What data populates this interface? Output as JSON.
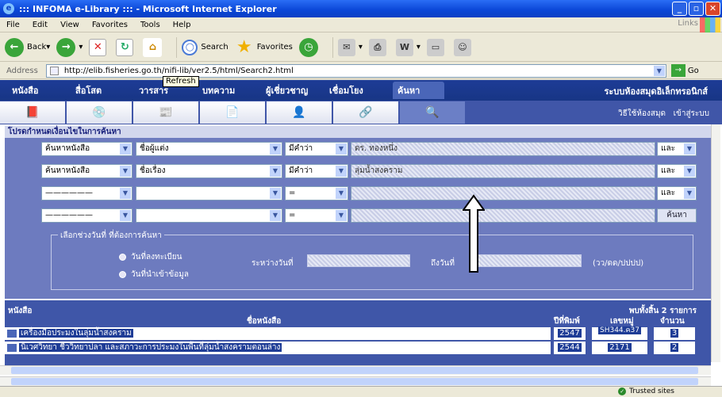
{
  "window": {
    "title": "::: INFOMA e-Library ::: - Microsoft Internet Explorer"
  },
  "menu": [
    "File",
    "Edit",
    "View",
    "Favorites",
    "Tools",
    "Help"
  ],
  "links_label": "Links",
  "toolbar": {
    "back": "Back",
    "search": "Search",
    "favorites": "Favorites"
  },
  "address": {
    "label": "Address",
    "url": "http://elib.fisheries.go.th/nifi-lib/ver2.5/html/Search2.html",
    "go": "Go"
  },
  "tooltip": "Refresh",
  "nav": {
    "tabs": [
      "หนังสือ",
      "สื่อโสต",
      "วารสาร",
      "บทความ",
      "ผู้เชี่ยวชาญ",
      "เชื่อมโยง",
      "ค้นหา"
    ],
    "system_title": "ระบบห้องสมุดอิเล็กทรอนิกส์",
    "how_to": "วิธีใช้ห้องสมุด",
    "login": "เข้าสู่ระบบ"
  },
  "search_panel": {
    "heading": "โปรดกำหนดเงื่อนไขในการค้นหา",
    "rows": [
      {
        "type": "ค้นหาหนังสือ",
        "field": "ชื่อผู้แต่ง",
        "op": "มีคำว่า",
        "value": "ดร. ทองหนึ่ง",
        "logic": "และ"
      },
      {
        "type": "ค้นหาหนังสือ",
        "field": "ชื่อเรื่อง",
        "op": "มีคำว่า",
        "value": "ลุ่มน้ำสงคราม",
        "logic": "และ"
      },
      {
        "type": "——————",
        "field": "",
        "op": "=",
        "value": "",
        "logic": "และ"
      },
      {
        "type": "——————",
        "field": "",
        "op": "=",
        "value": "",
        "logic": ""
      }
    ],
    "search_button": "ค้นหา",
    "date_range": {
      "legend": "เลือกช่วงวันที่ ที่ต้องการค้นหา",
      "option_registered": "วันที่ลงทะเบียน",
      "option_entered": "วันที่นำเข้าข้อมูล",
      "between_label": "ระหว่างวันที่",
      "to_label": "ถึงวันที่",
      "format_hint": "(วว/ดด/ปปปป)"
    }
  },
  "results": {
    "heading": "หนังสือ",
    "count_text": "พบทั้งสิ้น 2 รายการ",
    "columns": [
      "ชื่อหนังสือ",
      "ปีที่พิมพ์",
      "เลขหมู่",
      "จำนวน"
    ],
    "rows": [
      {
        "title": "เครื่องมือประมงในลุ่มน้ำสงคราม",
        "year": "2547",
        "call_no": "SH344.ค37",
        "qty": "3"
      },
      {
        "title": "นิเวศวิทยา ชีววิทยาปลา และสภาวะการประมงในพื้นที่ลุ่มน้ำสงครามตอนล่าง",
        "year": "2544",
        "call_no": "2171",
        "qty": "2"
      }
    ]
  },
  "status": {
    "zone": "Trusted sites"
  }
}
